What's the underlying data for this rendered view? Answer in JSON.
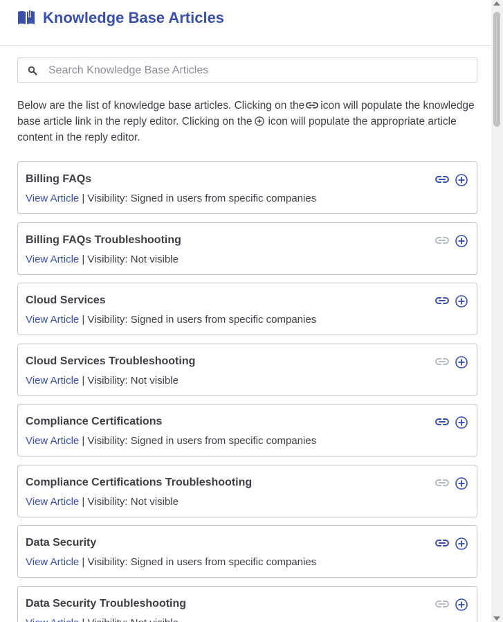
{
  "header": {
    "title": "Knowledge Base Articles",
    "icon": "book-open-icon",
    "accent": "#3a4fa8"
  },
  "search": {
    "placeholder": "Search Knowledge Base Articles",
    "icon": "search-icon"
  },
  "description": {
    "part1": "Below are the list of knowledge base articles. Clicking on the",
    "part2": "icon will populate the knowledge base article link in the reply editor. Clicking on the",
    "part3": "icon will populate the appropriate article content in the reply editor."
  },
  "colors": {
    "link_active": "#3a4fa8",
    "link_disabled": "#b5b9c0",
    "border": "#bfc4cc",
    "text": "#3c3f46"
  },
  "articles": [
    {
      "title": "Billing FAQs",
      "link_label": "View Article",
      "visibility": " | Visibility: Signed in users from specific companies",
      "link_enabled": true
    },
    {
      "title": "Billing FAQs Troubleshooting",
      "link_label": "View Article",
      "visibility": " | Visibility: Not visible",
      "link_enabled": false
    },
    {
      "title": "Cloud Services",
      "link_label": "View Article",
      "visibility": " | Visibility: Signed in users from specific companies",
      "link_enabled": true
    },
    {
      "title": "Cloud Services Troubleshooting",
      "link_label": "View Article",
      "visibility": " | Visibility: Not visible",
      "link_enabled": false
    },
    {
      "title": "Compliance Certifications",
      "link_label": "View Article",
      "visibility": " | Visibility: Signed in users from specific companies",
      "link_enabled": true
    },
    {
      "title": "Compliance Certifications Troubleshooting",
      "link_label": "View Article",
      "visibility": " | Visibility: Not visible",
      "link_enabled": false
    },
    {
      "title": "Data Security",
      "link_label": "View Article",
      "visibility": " | Visibility: Signed in users from specific companies",
      "link_enabled": true
    },
    {
      "title": "Data Security Troubleshooting",
      "link_label": "View Article",
      "visibility": " | Visibility: Not visible",
      "link_enabled": false
    }
  ]
}
